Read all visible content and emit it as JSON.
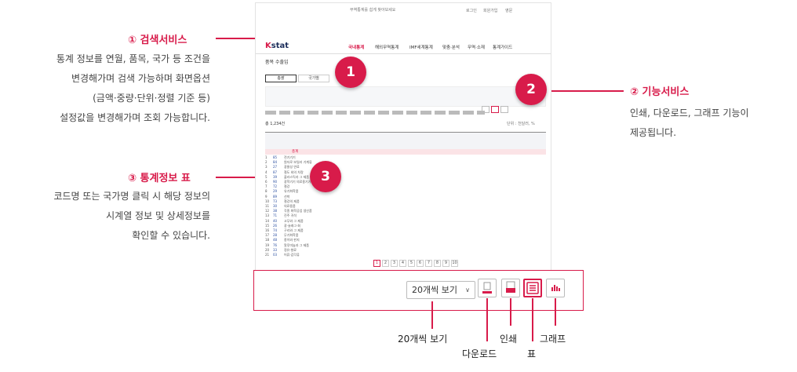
{
  "annotations": {
    "search": {
      "title": "① 검색서비스",
      "lines": [
        "통계 정보를 연월, 품목, 국가 등 조건을",
        "변경해가며 검색 가능하며 화면옵션",
        "(금액·중량·단위·정렬 기준 등)",
        "설정값을 변경해가며 조회 가능합니다."
      ]
    },
    "function": {
      "title": "② 기능서비스",
      "lines": [
        "인쇄, 다운로드, 그래프 기능이",
        "제공됩니다."
      ]
    },
    "table": {
      "title": "③ 통계정보 표",
      "lines": [
        "코드명 또는 국가명 클릭 시 해당 정보의",
        "시계열 정보 및 상세정보를",
        "확인할 수 있습니다."
      ]
    }
  },
  "markers": [
    "1",
    "2",
    "3"
  ],
  "site": {
    "logo_main": "K",
    "logo_rest": "stat",
    "top_links": [
      "로그인",
      "회원가입",
      "영문"
    ],
    "nav": [
      "국내통계",
      "해외무역통계",
      "IMF세계통계",
      "맞춤·분석",
      "무역·소재",
      "통계가이드"
    ],
    "page_title": "품목 수출입",
    "tabs": [
      "총괄",
      "국가별"
    ],
    "table_title": "단위 : 천달러, %",
    "sum_label": "총계",
    "rows": [
      {
        "code": "85",
        "name": "전기기기"
      },
      {
        "code": "84",
        "name": "원자로 보일러 기계류"
      },
      {
        "code": "27",
        "name": "광물성 연료"
      },
      {
        "code": "87",
        "name": "철도 외의 차량"
      },
      {
        "code": "39",
        "name": "플라스틱과 그 제품"
      },
      {
        "code": "90",
        "name": "광학기기 의료용기기"
      },
      {
        "code": "72",
        "name": "철강"
      },
      {
        "code": "29",
        "name": "유기화학품"
      },
      {
        "code": "89",
        "name": "선박"
      },
      {
        "code": "73",
        "name": "철강의 제품"
      },
      {
        "code": "30",
        "name": "의료용품"
      },
      {
        "code": "38",
        "name": "각종 화학공업 생산품"
      },
      {
        "code": "71",
        "name": "진주 귀석"
      },
      {
        "code": "40",
        "name": "고무와 그 제품"
      },
      {
        "code": "26",
        "name": "광·슬래그·회"
      },
      {
        "code": "74",
        "name": "구리와 그 제품"
      },
      {
        "code": "28",
        "name": "무기화학품"
      },
      {
        "code": "48",
        "name": "종이와 판지"
      },
      {
        "code": "76",
        "name": "알루미늄과 그 제품"
      },
      {
        "code": "33",
        "name": "정유·향료"
      },
      {
        "code": "03",
        "name": "어류·갑각류"
      }
    ],
    "pages": [
      "1",
      "2",
      "3",
      "4",
      "5",
      "6",
      "7",
      "8",
      "9",
      "10"
    ]
  },
  "toolbar": {
    "select_value": "20개씩 보기",
    "chevron": "∨",
    "labels": {
      "view": "20개씩 보기",
      "download": "다운로드",
      "print": "인쇄",
      "table": "표",
      "graph": "그래프"
    }
  },
  "colors": {
    "accent": "#d81b4a",
    "navy": "#1c2d5a",
    "link": "#2a4ea0"
  }
}
